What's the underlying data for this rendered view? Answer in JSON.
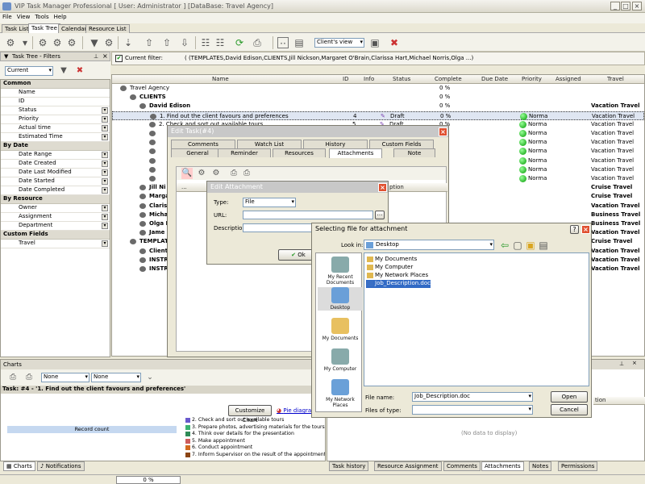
{
  "app": {
    "title": "VIP Task Manager Professional [ User: Administrator ] [DataBase: Travel Agency]"
  },
  "menu": [
    "File",
    "View",
    "Tools",
    "Help"
  ],
  "tabs": [
    "Task List",
    "Task Tree",
    "Calendar",
    "Resource List"
  ],
  "toolbar": {
    "view_select": "Client's view"
  },
  "filters": {
    "title": "Task Tree - Filters",
    "preset": "Current",
    "sections": [
      {
        "name": "Common",
        "items": [
          "Name",
          "ID",
          "Status",
          "Priority",
          "Actual time",
          "Estimated Time"
        ]
      },
      {
        "name": "By Date",
        "items": [
          "Date Range",
          "Date Created",
          "Date Last Modified",
          "Date Started",
          "Date Completed"
        ]
      },
      {
        "name": "By Resource",
        "items": [
          "Owner",
          "Assignment",
          "Department"
        ]
      },
      {
        "name": "Custom Fields",
        "items": [
          "Travel"
        ]
      }
    ]
  },
  "current_filter": {
    "label": "Current filter:",
    "value": "( (TEMPLATES,David Edison,CLIENTS,Jill Nickson,Margaret O'Brain,Clarissa Hart,Michael Norris,Olga ...)"
  },
  "grid": {
    "columns": [
      "Name",
      "ID",
      "Info",
      "Status",
      "Complete",
      "Due Date",
      "Priority",
      "Assigned",
      "Travel"
    ],
    "rows": [
      {
        "name": "Travel Agency",
        "complete": "0 %"
      },
      {
        "name": "CLIENTS",
        "complete": "0 %"
      },
      {
        "name": "David Edison",
        "complete": "0 %",
        "travel": "Vacation Travel"
      },
      {
        "name": "1. Find out the client favours and preferences",
        "id": "4",
        "status": "Draft",
        "complete": "0 %",
        "priority": "Norma",
        "travel": "Vacation Travel"
      },
      {
        "name": "2. Check and sort out available tours",
        "id": "5",
        "status": "Draft",
        "complete": "0 %",
        "priority": "Norma",
        "travel": "Vacation Travel"
      },
      {
        "name": "",
        "priority": "Norma",
        "travel": "Vacation Travel"
      },
      {
        "name": "",
        "priority": "Norma",
        "travel": "Vacation Travel"
      },
      {
        "name": "",
        "priority": "Norma",
        "travel": "Vacation Travel"
      },
      {
        "name": "",
        "priority": "Norma",
        "travel": "Vacation Travel"
      },
      {
        "name": "",
        "priority": "Norma",
        "travel": "Vacation Travel"
      },
      {
        "name": "",
        "priority": "Norma",
        "travel": "Vacation Travel"
      },
      {
        "name": "Jill Ni",
        "travel": "Cruise Travel"
      },
      {
        "name": "Marga",
        "travel": "Cruise Travel"
      },
      {
        "name": "Claris",
        "travel": "Vacation Travel"
      },
      {
        "name": "Micha",
        "travel": "Business Travel"
      },
      {
        "name": "Olga I",
        "travel": "Business Travel"
      },
      {
        "name": "Jame",
        "travel": "Vacation Travel"
      },
      {
        "name": "TEMPLAT",
        "travel": "Cruise Travel"
      },
      {
        "name": "Client",
        "travel": "Vacation Travel"
      },
      {
        "name": "INSTR",
        "travel": "Vacation Travel"
      },
      {
        "name": "INSTR",
        "travel": "Vacation Travel"
      }
    ]
  },
  "edit_task": {
    "title": "Edit Task(#4)",
    "tabs_row1": [
      "Comments",
      "Watch List",
      "History",
      "Custom Fields"
    ],
    "tabs_row2": [
      "General",
      "Reminder",
      "Resources",
      "Attachments",
      "Note"
    ],
    "col_desc": "ption"
  },
  "edit_attachment": {
    "title": "Edit Attachment",
    "type_label": "Type:",
    "type_value": "File",
    "url_label": "URL:",
    "desc_label": "Description:",
    "ok": "Ok"
  },
  "file_dialog": {
    "title": "Selecting file for attachment",
    "look_in_label": "Look in:",
    "look_in": "Desktop",
    "places": [
      "My Recent Documents",
      "Desktop",
      "My Documents",
      "My Computer",
      "My Network Places"
    ],
    "files": [
      "My Documents",
      "My Computer",
      "My Network Places",
      "Job_Description.doc"
    ],
    "file_name_label": "File name:",
    "file_name": "Job_Description.doc",
    "file_type_label": "Files of type:",
    "open": "Open",
    "cancel": "Cancel"
  },
  "charts": {
    "title": "Charts",
    "sel1": "None",
    "sel2": "None",
    "task_line": "Task: #4 - '1. Find out the client favours and preferences'",
    "customize": "Customize Chart",
    "pie": "Pie diagra",
    "record_count": "Record count",
    "legend": [
      "2. Check and sort out available tours",
      "3. Prepare photos, advertising materials for the tours",
      "4. Think over details for the presentation",
      "5. Make appointment",
      "6. Conduct appointment",
      "7. Inform Supervisor on the result of the appointment"
    ],
    "legend_colors": [
      "#6a5acd",
      "#3cb371",
      "#2e8b57",
      "#cd5c5c",
      "#d2691e",
      "#8b4513"
    ]
  },
  "right_panel": {
    "col": "tion",
    "nodata": "(No data to display)"
  },
  "bottom_tabs_left": [
    "Charts",
    "Notifications"
  ],
  "bottom_tabs_right": [
    "Task history",
    "Resource Assignment",
    "Comments",
    "Attachments",
    "Notes",
    "Permissions"
  ],
  "status": {
    "progress": "0 %"
  }
}
